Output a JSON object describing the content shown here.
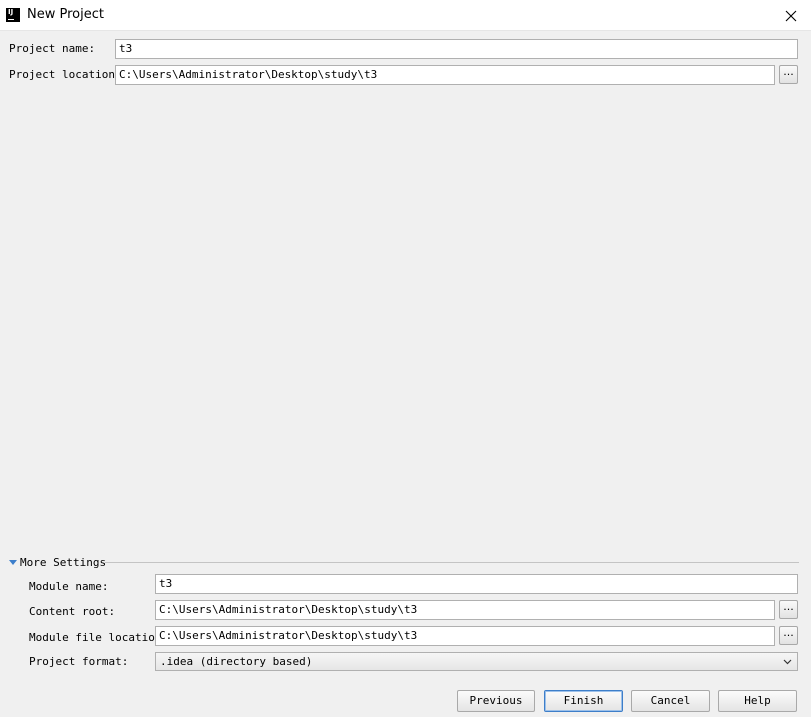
{
  "window": {
    "title": "New Project",
    "logo_text": "IJ"
  },
  "project": {
    "name_label": "Project name:",
    "name_value": "t3",
    "location_label": "Project location:",
    "location_value": "C:\\Users\\Administrator\\Desktop\\study\\t3",
    "browse_label": "..."
  },
  "more_settings": {
    "title": "More Settings",
    "module_name_label": "Module name:",
    "module_name_value": "t3",
    "content_root_label": "Content root:",
    "content_root_value": "C:\\Users\\Administrator\\Desktop\\study\\t3",
    "module_file_label": "Module file location:",
    "module_file_value": "C:\\Users\\Administrator\\Desktop\\study\\t3",
    "format_label": "Project format:",
    "format_value": ".idea (directory based)",
    "browse_label": "..."
  },
  "buttons": {
    "previous": "Previous",
    "finish": "Finish",
    "cancel": "Cancel",
    "help": "Help"
  },
  "colors": {
    "accent": "#3c7ecb",
    "background": "#f0f0f0"
  }
}
